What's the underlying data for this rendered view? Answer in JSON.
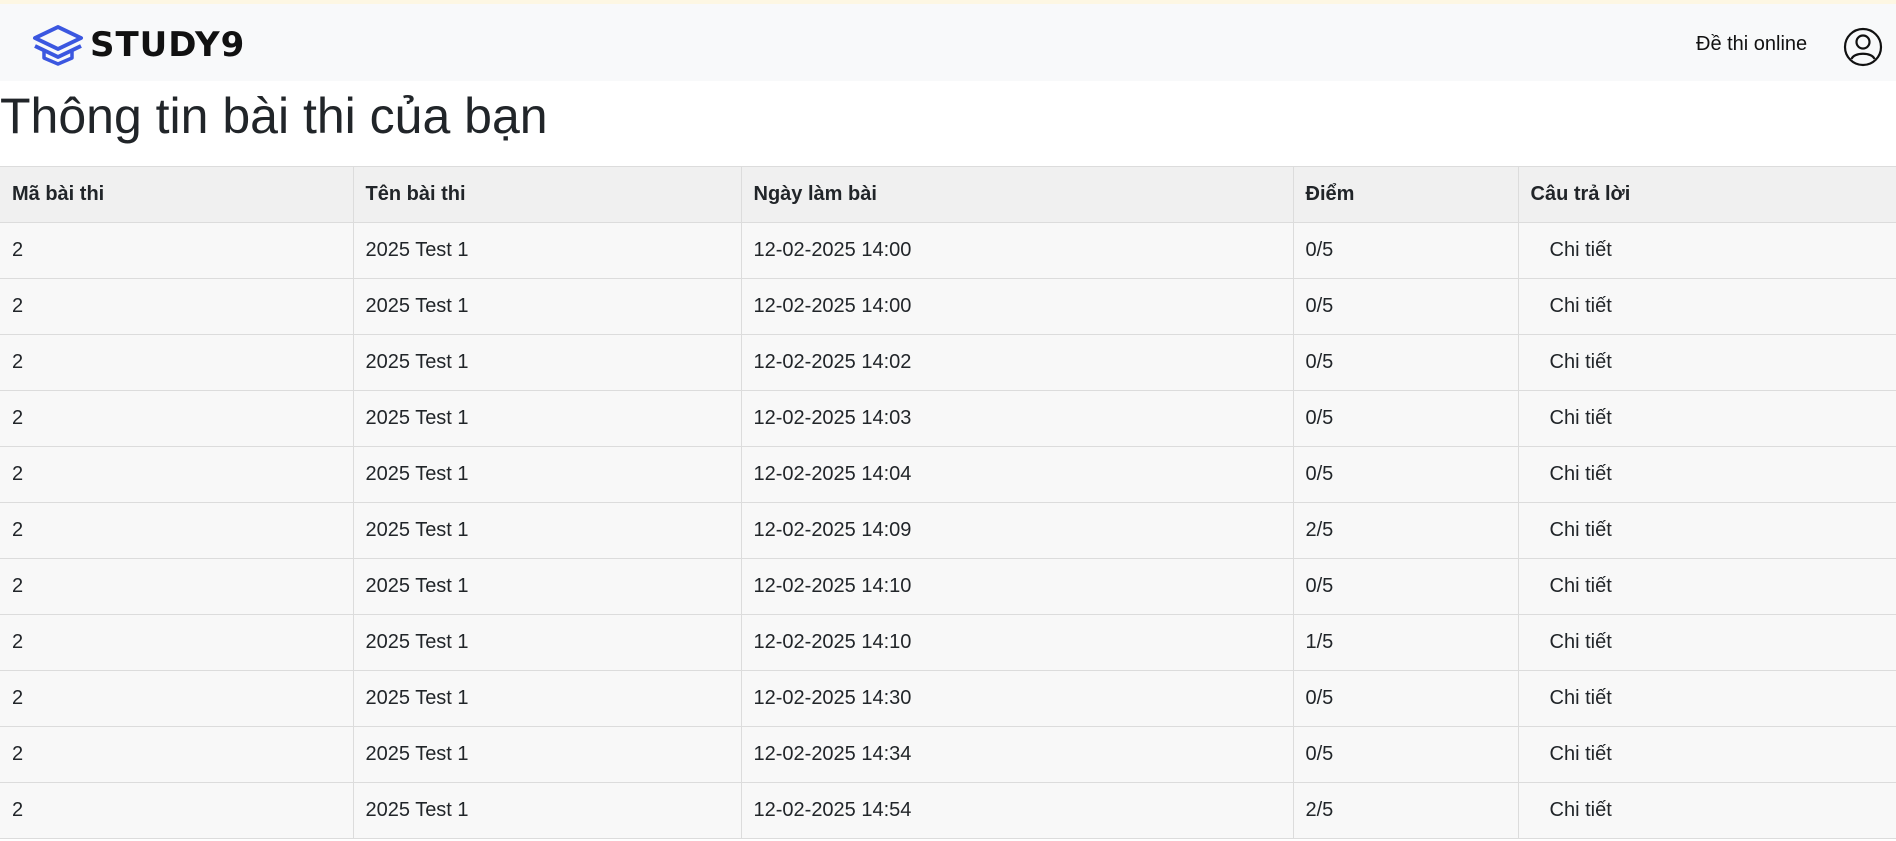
{
  "brand": {
    "name": "STUDY9",
    "accent_color": "#3b57e0"
  },
  "nav": {
    "online_exams_label": "Đề thi online",
    "account_icon": "user-circle-icon"
  },
  "page": {
    "title": "Thông tin bài thi của bạn"
  },
  "table": {
    "headers": [
      "Mã bài thi",
      "Tên bài thi",
      "Ngày làm bài",
      "Điểm",
      "Câu trả lời"
    ],
    "rows": [
      {
        "id": "2",
        "name": "2025 Test 1",
        "date": "12-02-2025 14:00",
        "score": "0/5",
        "action": "Chi tiết"
      },
      {
        "id": "2",
        "name": "2025 Test 1",
        "date": "12-02-2025 14:00",
        "score": "0/5",
        "action": "Chi tiết"
      },
      {
        "id": "2",
        "name": "2025 Test 1",
        "date": "12-02-2025 14:02",
        "score": "0/5",
        "action": "Chi tiết"
      },
      {
        "id": "2",
        "name": "2025 Test 1",
        "date": "12-02-2025 14:03",
        "score": "0/5",
        "action": "Chi tiết"
      },
      {
        "id": "2",
        "name": "2025 Test 1",
        "date": "12-02-2025 14:04",
        "score": "0/5",
        "action": "Chi tiết"
      },
      {
        "id": "2",
        "name": "2025 Test 1",
        "date": "12-02-2025 14:09",
        "score": "2/5",
        "action": "Chi tiết"
      },
      {
        "id": "2",
        "name": "2025 Test 1",
        "date": "12-02-2025 14:10",
        "score": "0/5",
        "action": "Chi tiết"
      },
      {
        "id": "2",
        "name": "2025 Test 1",
        "date": "12-02-2025 14:10",
        "score": "1/5",
        "action": "Chi tiết"
      },
      {
        "id": "2",
        "name": "2025 Test 1",
        "date": "12-02-2025 14:30",
        "score": "0/5",
        "action": "Chi tiết"
      },
      {
        "id": "2",
        "name": "2025 Test 1",
        "date": "12-02-2025 14:34",
        "score": "0/5",
        "action": "Chi tiết"
      },
      {
        "id": "2",
        "name": "2025 Test 1",
        "date": "12-02-2025 14:54",
        "score": "2/5",
        "action": "Chi tiết"
      }
    ]
  }
}
